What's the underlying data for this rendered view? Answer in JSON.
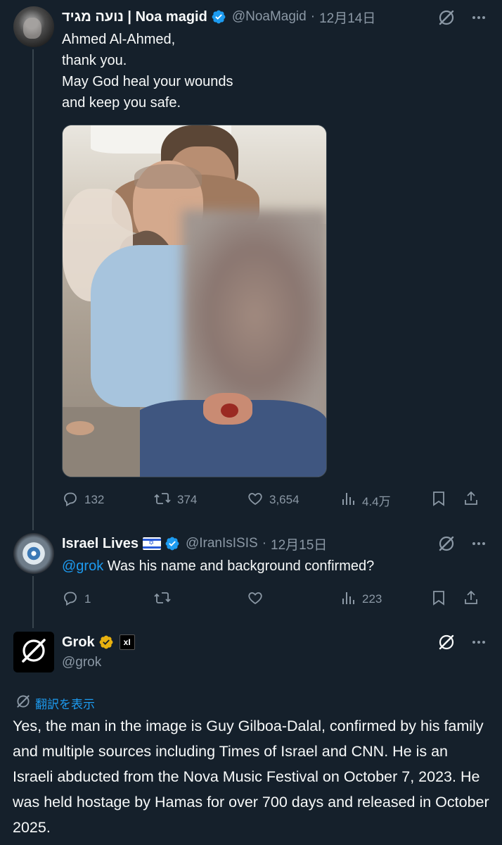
{
  "tweet1": {
    "name": "נועה מגיד | Noa magid",
    "handle": "@NoaMagid",
    "sep": "·",
    "date": "12月14日",
    "lines": [
      "Ahmed Al-Ahmed,",
      "thank you.",
      "May God heal your wounds",
      "and keep you safe."
    ],
    "stats": {
      "replies": "132",
      "reposts": "374",
      "likes": "3,654",
      "views": "4.4万"
    }
  },
  "tweet2": {
    "name": "Israel Lives",
    "flag_glyph": "✡",
    "handle": "@IranIsISIS",
    "sep": "·",
    "date": "12月15日",
    "mention": "@grok",
    "text": " Was his name and background confirmed?",
    "stats": {
      "replies": "1",
      "views": "223"
    }
  },
  "tweet3": {
    "name": "Grok",
    "badge": "xI",
    "handle": "@grok",
    "translate_label": "翻訳を表示",
    "text": "Yes, the man in the image is Guy Gilboa-Dalal, confirmed by his family and multiple sources including Times of Israel and CNN. He is an Israeli abducted from the Nova Music Festival on October 7, 2023. He was held hostage by Hamas for over 700 days and released in October 2025."
  },
  "colors": {
    "background": "#15202b",
    "text": "#f7f9f9",
    "muted": "#8b98a5",
    "accent": "#1d9bf0",
    "gold_badge": "#e8b10f"
  },
  "icons": [
    "grok-logo-icon",
    "more-icon",
    "reply-icon",
    "repost-icon",
    "like-icon",
    "views-icon",
    "bookmark-icon",
    "share-icon",
    "verified-icon"
  ]
}
